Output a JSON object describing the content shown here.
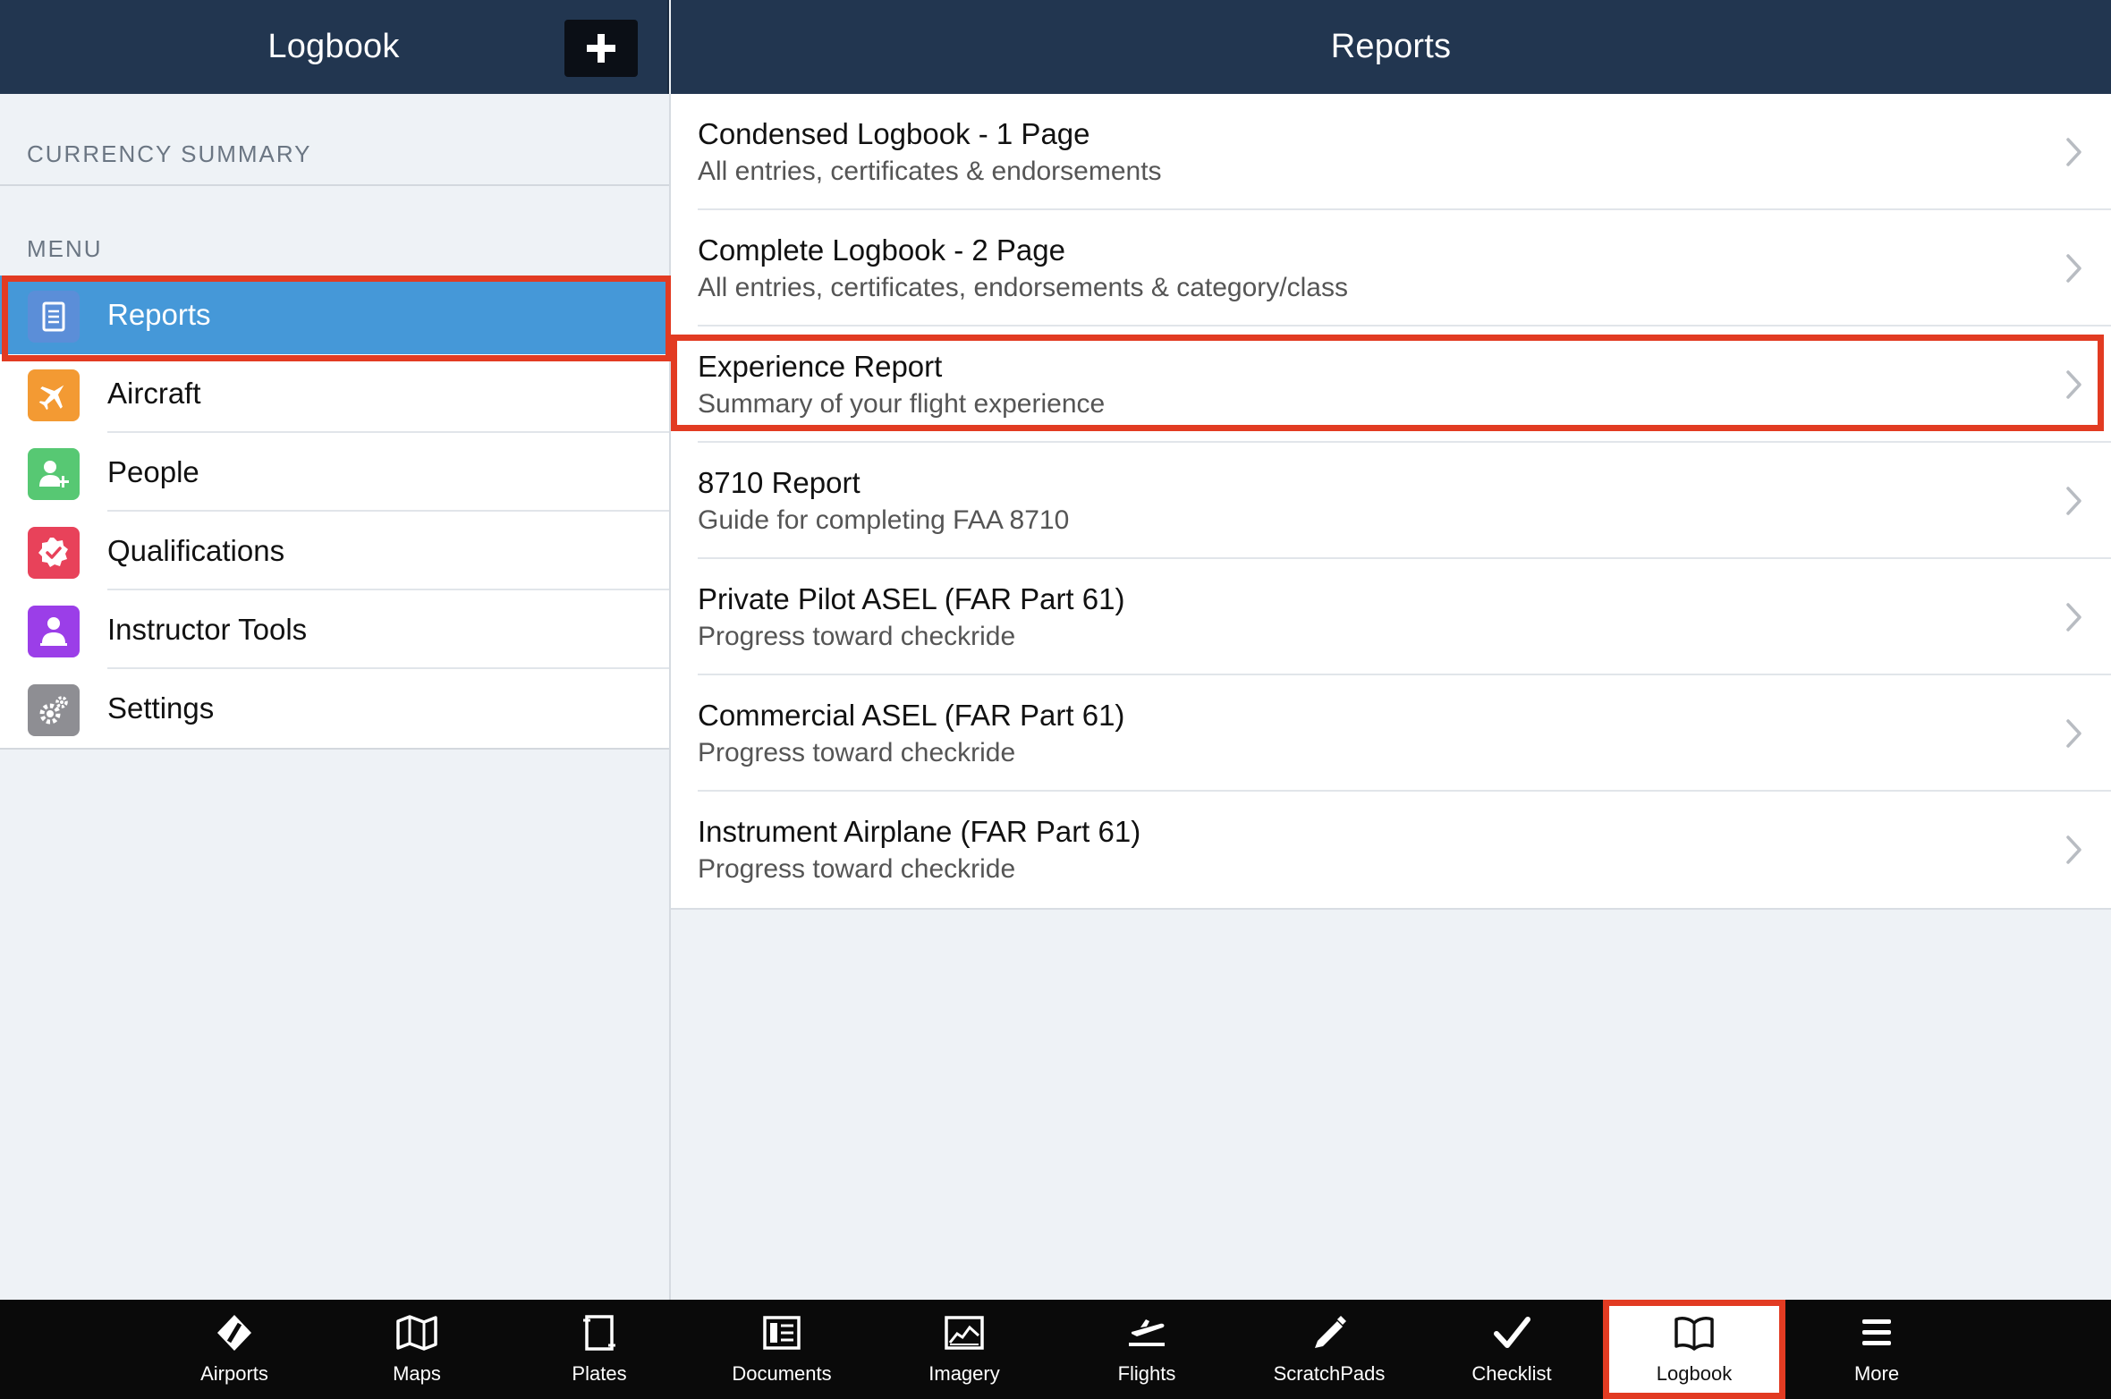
{
  "left_header": {
    "title": "Logbook"
  },
  "right_header": {
    "title": "Reports"
  },
  "sidebar": {
    "currency_summary_label": "CURRENCY SUMMARY",
    "menu_label": "MENU",
    "items": [
      {
        "label": "Reports",
        "icon": "reports-icon",
        "color": "#5b8ed8",
        "selected": true
      },
      {
        "label": "Aircraft",
        "icon": "airplane-icon",
        "color": "#f39a33"
      },
      {
        "label": "People",
        "icon": "add-person-icon",
        "color": "#57c873"
      },
      {
        "label": "Qualifications",
        "icon": "badge-check-icon",
        "color": "#e8425a"
      },
      {
        "label": "Instructor Tools",
        "icon": "instructor-icon",
        "color": "#9b3ee8"
      },
      {
        "label": "Settings",
        "icon": "gear-icon",
        "color": "#8e8e93"
      }
    ]
  },
  "reports": [
    {
      "title": "Condensed Logbook - 1 Page",
      "subtitle": "All entries, certificates & endorsements"
    },
    {
      "title": "Complete Logbook - 2 Page",
      "subtitle": "All entries, certificates, endorsements & category/class"
    },
    {
      "title": "Experience Report",
      "subtitle": "Summary of your flight experience",
      "highlighted": true
    },
    {
      "title": "8710 Report",
      "subtitle": "Guide for completing FAA 8710"
    },
    {
      "title": "Private Pilot ASEL (FAR Part 61)",
      "subtitle": "Progress toward checkride"
    },
    {
      "title": "Commercial ASEL (FAR Part 61)",
      "subtitle": "Progress toward checkride"
    },
    {
      "title": "Instrument Airplane (FAR Part 61)",
      "subtitle": "Progress toward checkride"
    }
  ],
  "tabbar": [
    {
      "label": "Airports",
      "icon": "airports-icon"
    },
    {
      "label": "Maps",
      "icon": "map-icon"
    },
    {
      "label": "Plates",
      "icon": "plates-icon"
    },
    {
      "label": "Documents",
      "icon": "documents-icon"
    },
    {
      "label": "Imagery",
      "icon": "imagery-icon"
    },
    {
      "label": "Flights",
      "icon": "flights-icon"
    },
    {
      "label": "ScratchPads",
      "icon": "pencil-icon"
    },
    {
      "label": "Checklist",
      "icon": "checkmark-icon"
    },
    {
      "label": "Logbook",
      "icon": "book-icon",
      "selected": true
    },
    {
      "label": "More",
      "icon": "menu-icon"
    }
  ],
  "colors": {
    "header": "#223650",
    "selection": "#4598d8",
    "annotation": "#e23b22"
  }
}
